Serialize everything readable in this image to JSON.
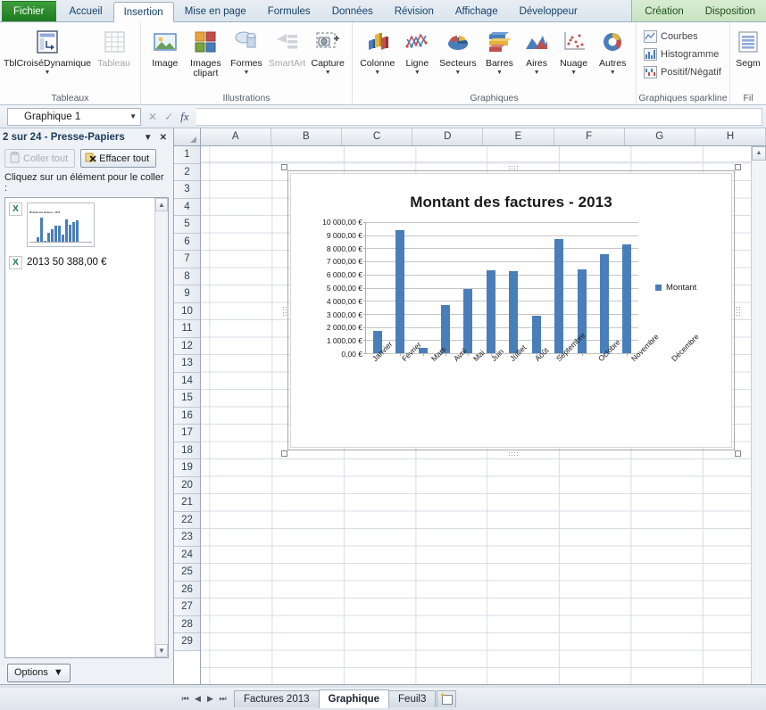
{
  "ribbon": {
    "tabs": [
      {
        "label": "Fichier",
        "type": "file"
      },
      {
        "label": "Accueil",
        "type": "normal"
      },
      {
        "label": "Insertion",
        "type": "active"
      },
      {
        "label": "Mise en page",
        "type": "normal"
      },
      {
        "label": "Formules",
        "type": "normal"
      },
      {
        "label": "Données",
        "type": "normal"
      },
      {
        "label": "Révision",
        "type": "normal"
      },
      {
        "label": "Affichage",
        "type": "normal"
      },
      {
        "label": "Développeur",
        "type": "normal"
      }
    ],
    "contextual_tabs": [
      {
        "label": "Création"
      },
      {
        "label": "Disposition"
      }
    ],
    "groups": [
      {
        "title": "Tableaux",
        "buttons": [
          {
            "label": "TblCroiséDynamique",
            "icon": "pivot-table-icon",
            "caret": true,
            "dim": false
          },
          {
            "label": "Tableau",
            "icon": "table-icon",
            "caret": false,
            "dim": true
          }
        ]
      },
      {
        "title": "Illustrations",
        "buttons": [
          {
            "label": "Image",
            "icon": "picture-icon",
            "caret": false,
            "dim": false
          },
          {
            "label": "Images clipart",
            "icon": "clipart-icon",
            "caret": false,
            "dim": false
          },
          {
            "label": "Formes",
            "icon": "shapes-icon",
            "caret": true,
            "dim": false
          },
          {
            "label": "SmartArt",
            "icon": "smartart-icon",
            "caret": false,
            "dim": true
          },
          {
            "label": "Capture",
            "icon": "screenshot-icon",
            "caret": true,
            "dim": false
          }
        ]
      },
      {
        "title": "Graphiques",
        "buttons": [
          {
            "label": "Colonne",
            "icon": "column-chart-icon",
            "caret": true,
            "dim": false
          },
          {
            "label": "Ligne",
            "icon": "line-chart-icon",
            "caret": true,
            "dim": false
          },
          {
            "label": "Secteurs",
            "icon": "pie-chart-icon",
            "caret": true,
            "dim": false
          },
          {
            "label": "Barres",
            "icon": "bar-chart-icon",
            "caret": true,
            "dim": false
          },
          {
            "label": "Aires",
            "icon": "area-chart-icon",
            "caret": true,
            "dim": false
          },
          {
            "label": "Nuage",
            "icon": "scatter-chart-icon",
            "caret": true,
            "dim": false
          },
          {
            "label": "Autres",
            "icon": "other-chart-icon",
            "caret": true,
            "dim": false
          }
        ]
      },
      {
        "title": "Graphiques sparkline",
        "small_buttons": [
          {
            "label": "Courbes",
            "icon": "sparkline-line-icon"
          },
          {
            "label": "Histogramme",
            "icon": "sparkline-column-icon"
          },
          {
            "label": "Positif/Négatif",
            "icon": "sparkline-winloss-icon"
          }
        ]
      },
      {
        "title": "Fil",
        "buttons": [
          {
            "label": "Segm",
            "icon": "slicer-icon",
            "caret": false,
            "dim": false
          }
        ]
      }
    ]
  },
  "formula_bar": {
    "name_box_value": "Graphique 1",
    "fx_label": "fx",
    "formula_value": ""
  },
  "clipboard": {
    "title": "2 sur 24 - Presse-Papiers",
    "paste_all_label": "Coller tout",
    "clear_all_label": "Effacer tout",
    "hint": "Cliquez sur un élément pour le coller :",
    "items": [
      {
        "type": "thumbnail",
        "label": "Montant des factures - 2013"
      },
      {
        "type": "text",
        "label": "2013 50 388,00 €"
      }
    ],
    "options_label": "Options"
  },
  "grid": {
    "columns": [
      "A",
      "B",
      "C",
      "D",
      "E",
      "F",
      "G",
      "H"
    ],
    "rows": [
      1,
      2,
      3,
      4,
      5,
      6,
      7,
      8,
      9,
      10,
      11,
      12,
      13,
      14,
      15,
      16,
      17,
      18,
      19,
      20,
      21,
      22,
      23,
      24,
      25,
      26,
      27,
      28,
      29
    ]
  },
  "sheet_tabs": {
    "tabs": [
      {
        "label": "Factures 2013",
        "active": false
      },
      {
        "label": "Graphique",
        "active": true
      },
      {
        "label": "Feuil3",
        "active": false
      }
    ],
    "nav": [
      "⏮",
      "◀",
      "▶",
      "⏭"
    ]
  },
  "chart_data": {
    "type": "bar",
    "title": "Montant des factures - 2013",
    "categories": [
      "Janvier",
      "Février",
      "Mars",
      "Avril",
      "Mai",
      "Juin",
      "Juillet",
      "Août",
      "Septembre",
      "Octobre",
      "Novembre",
      "Décembre"
    ],
    "series": [
      {
        "name": "Montant",
        "values": [
          1700,
          9400,
          400,
          3650,
          4900,
          6300,
          6250,
          2850,
          8700,
          6400,
          7550,
          8300
        ],
        "color": "#4a7ebb"
      }
    ],
    "ytick_labels": [
      "10 000,00 €",
      "9 000,00 €",
      "8 000,00 €",
      "7 000,00 €",
      "6 000,00 €",
      "5 000,00 €",
      "4 000,00 €",
      "3 000,00 €",
      "2 000,00 €",
      "1 000,00 €",
      "0,00 €"
    ],
    "ylim": [
      0,
      10000
    ],
    "ytick_step": 1000,
    "xlabel": "",
    "ylabel": "",
    "grid": true,
    "legend_position": "right"
  }
}
